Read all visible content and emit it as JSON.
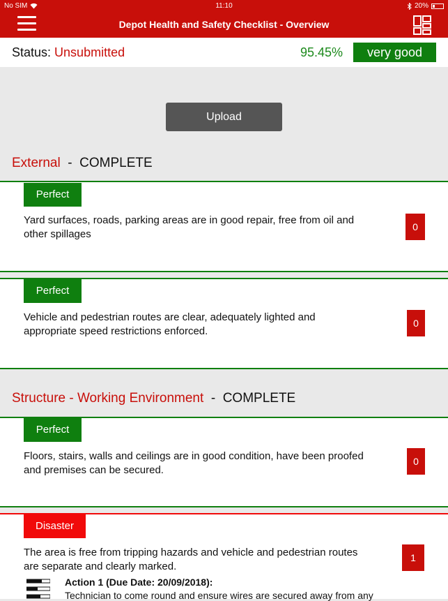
{
  "statusbar": {
    "carrier": "No SIM",
    "time": "11:10",
    "battery": "20%"
  },
  "nav": {
    "title": "Depot Health and Safety Checklist - Overview"
  },
  "summary": {
    "status_label": "Status:",
    "status_value": "Unsubmitted",
    "score": "95.45%",
    "rating": "very good"
  },
  "upload": {
    "label": "Upload"
  },
  "sections": [
    {
      "name": "External",
      "separator": "-",
      "state": "COMPLETE"
    },
    {
      "name": "Structure - Working Environment",
      "separator": "-",
      "state": "COMPLETE"
    }
  ],
  "questions": [
    {
      "badge": "Perfect",
      "text": "Yard surfaces, roads, parking areas are in good repair, free from oil and other spillages",
      "count": "0"
    },
    {
      "badge": "Perfect",
      "text": "Vehicle and pedestrian routes are clear, adequately lighted and appropriate speed restrictions enforced.",
      "count": "0"
    },
    {
      "badge": "Perfect",
      "text": "Floors, stairs, walls and ceilings are in good condition, have been proofed and premises can be secured.",
      "count": "0"
    },
    {
      "badge": "Disaster",
      "text": "The area is free from tripping hazards and vehicle and pedestrian routes are separate and clearly marked.",
      "count": "1"
    }
  ],
  "action": {
    "title": "Action 1 (Due Date: 20/09/2018):",
    "text": "Technician to come round and ensure wires are secured away from any"
  },
  "colors": {
    "brand_red": "#c80f0a",
    "good_green": "#0f7f0f",
    "disaster_red": "#f10a0a"
  }
}
